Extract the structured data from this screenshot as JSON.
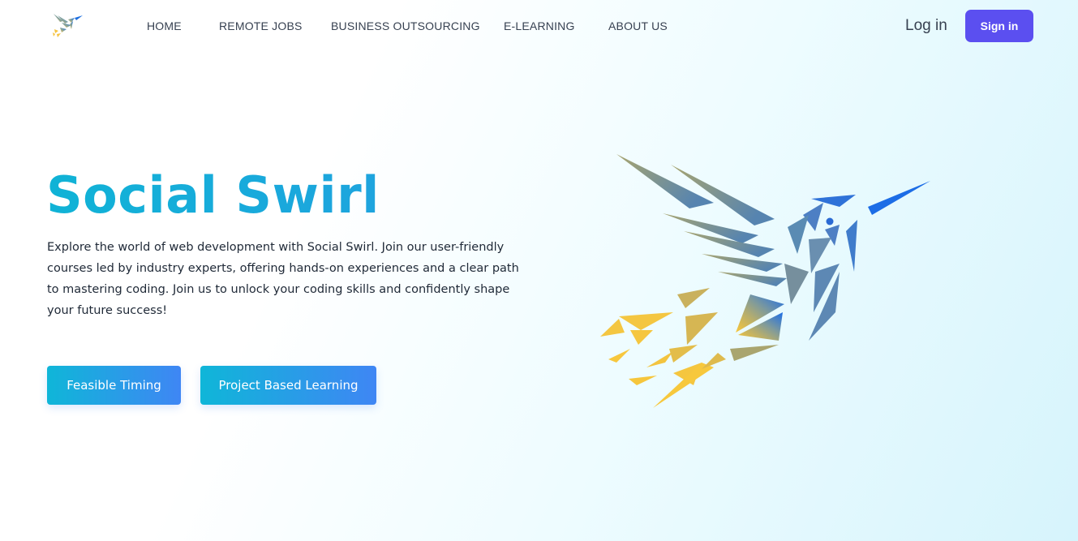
{
  "nav": {
    "links": [
      {
        "label": "HOME"
      },
      {
        "label": "REMOTE JOBS"
      },
      {
        "label": "BUSINESS OUTSOURCING"
      },
      {
        "label": "E-LEARNING"
      },
      {
        "label": "ABOUT US"
      }
    ],
    "login_label": "Log in",
    "signin_label": "Sign in"
  },
  "hero": {
    "title": "Social Swirl",
    "description": "Explore the world of web development with Social Swirl. Join our user-friendly courses led by industry experts, offering hands-on experiences and a clear path to mastering coding. Join us to unlock your coding skills and confidently shape your future success!",
    "buttons": [
      {
        "label": "Feasible Timing"
      },
      {
        "label": "Project Based Learning"
      }
    ]
  },
  "colors": {
    "accent": "#5b4ff0",
    "title_gradient_start": "#10b3d6",
    "button_gradient_start": "#0fb6d8",
    "button_gradient_end": "#3f86f4"
  },
  "icons": {
    "logo": "hummingbird-logo-icon",
    "hero_image": "hummingbird-illustration"
  }
}
